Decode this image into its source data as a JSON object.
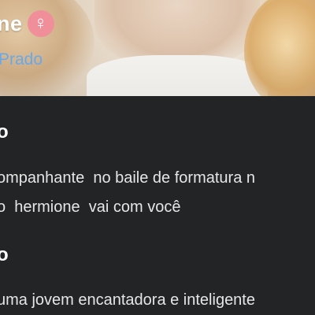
{
  "profile": {
    "name": "ne",
    "gender_symbol": "♀",
    "gender_color": "#f08e9a",
    "creator_link": "Prado",
    "creator_color": "#6aa8e8"
  },
  "sections": [
    {
      "title": "o",
      "lines": [
        "ompanhante  no baile de formatura n",
        "o  hermione  vai com você"
      ]
    },
    {
      "title": "o",
      "lines": [
        "uma jovem encantadora e inteligente"
      ]
    }
  ],
  "colors": {
    "background": "#222426",
    "text": "#e6e6e6"
  }
}
